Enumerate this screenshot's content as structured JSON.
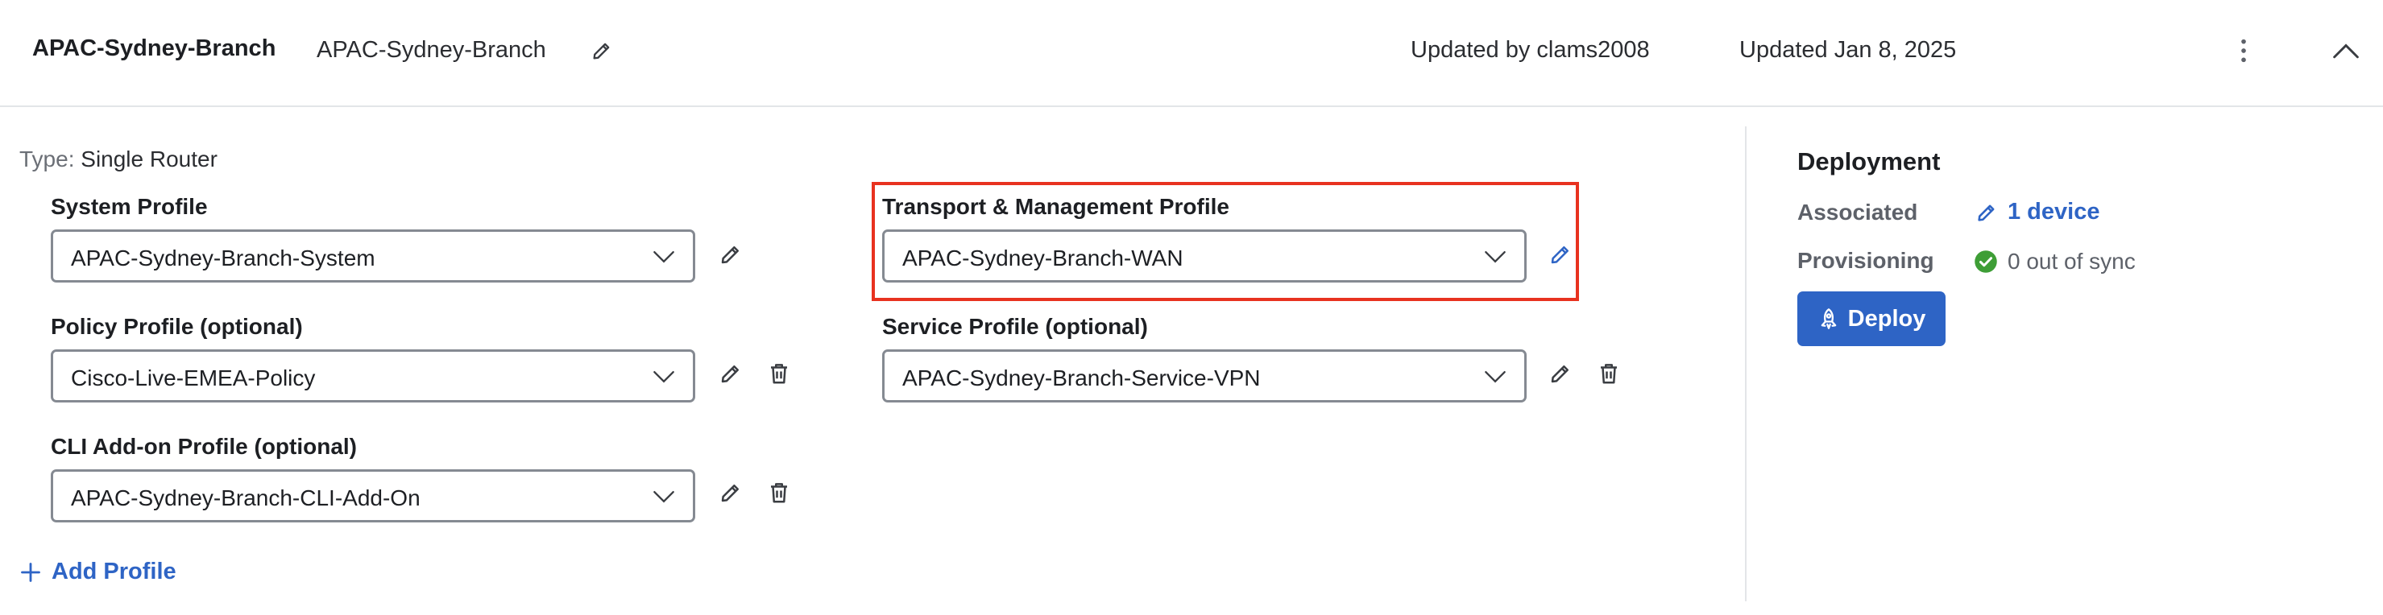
{
  "header": {
    "name": "APAC-Sydney-Branch",
    "description": "APAC-Sydney-Branch",
    "updated_by": "Updated by clams2008",
    "updated": "Updated Jan 8, 2025"
  },
  "type": {
    "label": "Type:",
    "value": "Single Router"
  },
  "profiles": {
    "system": {
      "label": "System Profile",
      "value": "APAC-Sydney-Branch-System"
    },
    "transport": {
      "label": "Transport & Management Profile",
      "value": "APAC-Sydney-Branch-WAN"
    },
    "policy": {
      "label": "Policy Profile (optional)",
      "value": "Cisco-Live-EMEA-Policy"
    },
    "service": {
      "label": "Service Profile (optional)",
      "value": "APAC-Sydney-Branch-Service-VPN"
    },
    "cli": {
      "label": "CLI Add-on Profile (optional)",
      "value": "APAC-Sydney-Branch-CLI-Add-On"
    }
  },
  "add_profile_label": "Add Profile",
  "deployment": {
    "title": "Deployment",
    "associated_label": "Associated",
    "associated_value": "1 device",
    "provisioning_label": "Provisioning",
    "provisioning_value": "0 out of sync",
    "deploy_label": "Deploy"
  },
  "icons": {
    "edit": "pencil-icon",
    "delete": "trash-icon",
    "more": "kebab-menu-icon",
    "collapse": "chevron-up-icon",
    "dropdown": "chevron-down-icon",
    "add": "plus-icon",
    "status_ok": "check-circle-icon",
    "deploy": "rocket-icon"
  },
  "colors": {
    "accent": "#2e64c5",
    "highlight": "#e8321f",
    "success": "#3e9e36"
  }
}
